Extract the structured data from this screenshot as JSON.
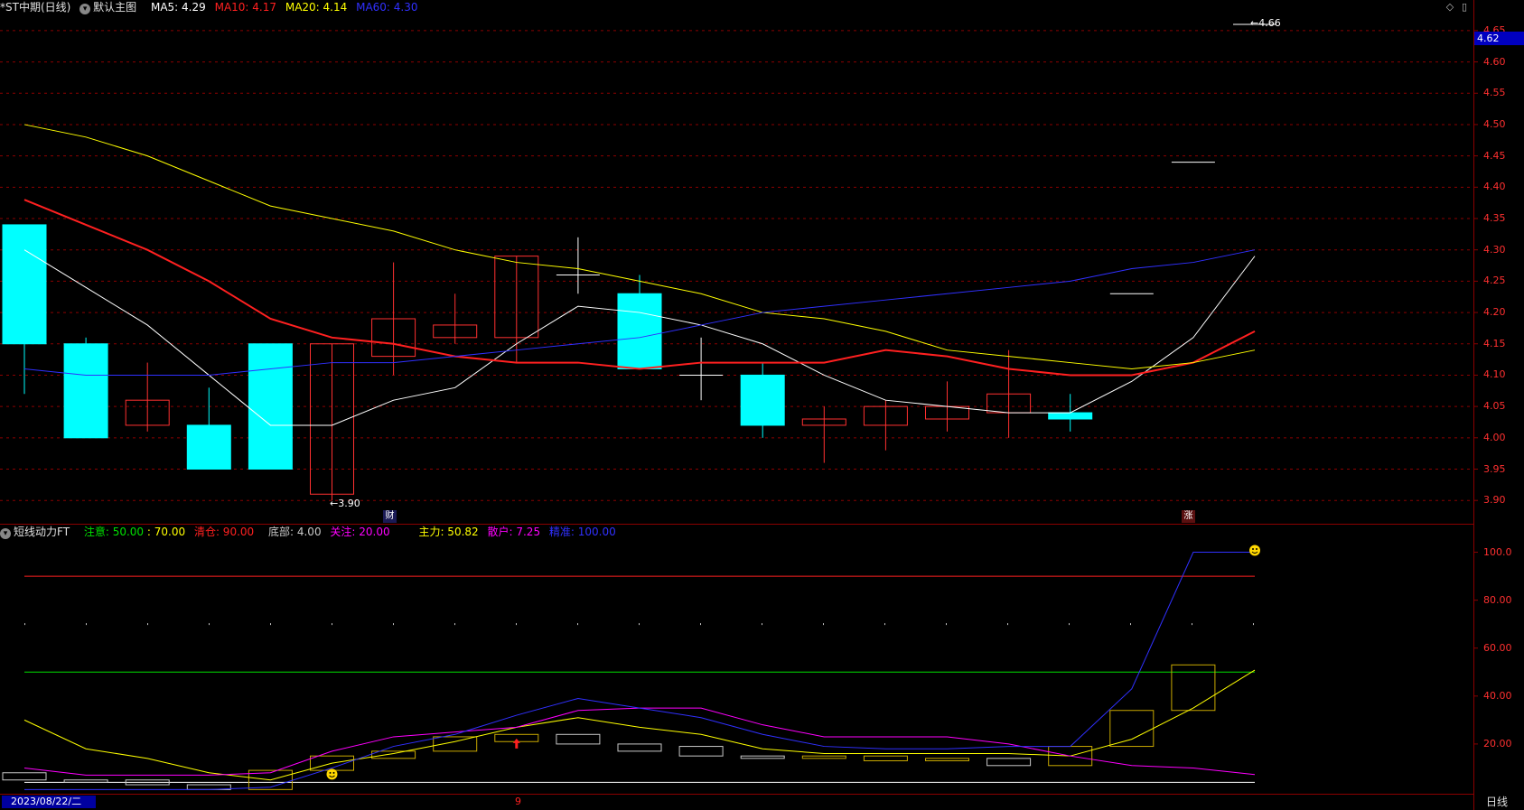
{
  "main": {
    "title": "*ST中期(日线)",
    "template": "默认主图",
    "ma_labels": [
      {
        "label": "MA5: 4.29",
        "color": "#ffffff"
      },
      {
        "label": "MA10: 4.17",
        "color": "#ff2020"
      },
      {
        "label": "MA20: 4.14",
        "color": "#ffff00"
      },
      {
        "label": "MA60: 4.30",
        "color": "#3030ff"
      }
    ],
    "current_price_tag": "4.62",
    "high_annotation": "←4.66",
    "low_annotation": "←3.90",
    "marker_cai": "财",
    "marker_zhang": "涨",
    "yticks": [
      "4.65",
      "4.60",
      "4.55",
      "4.50",
      "4.45",
      "4.40",
      "4.35",
      "4.30",
      "4.25",
      "4.20",
      "4.15",
      "4.10",
      "4.05",
      "4.00",
      "3.95",
      "3.90"
    ]
  },
  "sub": {
    "title": "短线动力FT",
    "labels": [
      {
        "label": "注意: 50.00",
        "color": "#00e000"
      },
      {
        "label": ": 70.00",
        "color": "#ffff00"
      },
      {
        "label": "清仓: 90.00",
        "color": "#ff2020"
      },
      {
        "label": "底部: 4.00",
        "color": "#c8c8c8"
      },
      {
        "label": "关注: 20.00",
        "color": "#ff00ff"
      },
      {
        "label": "主力: 50.82",
        "color": "#ffff00"
      },
      {
        "label": "散户: 7.25",
        "color": "#ff00ff"
      },
      {
        "label": "精准: 100.00",
        "color": "#3030ff"
      }
    ],
    "yticks": [
      "100.0",
      "80.00",
      "60.00",
      "40.00",
      "20.00"
    ]
  },
  "footer": {
    "date": "2023/08/22/二",
    "marker": "9",
    "period": "日线"
  },
  "chart_data": [
    {
      "type": "candlestick",
      "ylim": [
        3.87,
        4.67
      ],
      "candles": [
        {
          "o": 4.34,
          "h": 4.34,
          "l": 4.07,
          "c": 4.15
        },
        {
          "o": 4.15,
          "h": 4.16,
          "l": 4.0,
          "c": 4.0
        },
        {
          "o": 4.02,
          "h": 4.12,
          "l": 4.01,
          "c": 4.06
        },
        {
          "o": 4.02,
          "h": 4.08,
          "l": 3.95,
          "c": 3.95
        },
        {
          "o": 4.15,
          "h": 4.15,
          "l": 3.95,
          "c": 3.95
        },
        {
          "o": 3.91,
          "h": 4.15,
          "l": 3.9,
          "c": 4.15
        },
        {
          "o": 4.13,
          "h": 4.28,
          "l": 4.1,
          "c": 4.19
        },
        {
          "o": 4.16,
          "h": 4.23,
          "l": 4.15,
          "c": 4.18
        },
        {
          "o": 4.16,
          "h": 4.29,
          "l": 4.12,
          "c": 4.29
        },
        {
          "o": 4.26,
          "h": 4.32,
          "l": 4.23,
          "c": 4.26
        },
        {
          "o": 4.23,
          "h": 4.26,
          "l": 4.11,
          "c": 4.11
        },
        {
          "o": 4.1,
          "h": 4.16,
          "l": 4.06,
          "c": 4.1
        },
        {
          "o": 4.1,
          "h": 4.12,
          "l": 4.0,
          "c": 4.02
        },
        {
          "o": 4.02,
          "h": 4.05,
          "l": 3.96,
          "c": 4.03
        },
        {
          "o": 4.02,
          "h": 4.06,
          "l": 3.98,
          "c": 4.05
        },
        {
          "o": 4.03,
          "h": 4.09,
          "l": 4.01,
          "c": 4.05
        },
        {
          "o": 4.04,
          "h": 4.14,
          "l": 4.0,
          "c": 4.07
        },
        {
          "o": 4.04,
          "h": 4.07,
          "l": 4.01,
          "c": 4.03
        },
        {
          "o": 4.23,
          "h": 4.23,
          "l": 4.23,
          "c": 4.23
        },
        {
          "o": 4.44,
          "h": 4.44,
          "l": 4.44,
          "c": 4.44
        },
        {
          "o": 4.66,
          "h": 4.66,
          "l": 4.66,
          "c": 4.66
        }
      ],
      "series": [
        {
          "name": "MA5",
          "color": "#ffffff",
          "values": [
            4.3,
            4.24,
            4.18,
            4.1,
            4.02,
            4.02,
            4.06,
            4.08,
            4.15,
            4.21,
            4.2,
            4.18,
            4.15,
            4.1,
            4.06,
            4.05,
            4.04,
            4.04,
            4.09,
            4.16,
            4.29
          ]
        },
        {
          "name": "MA10",
          "color": "#ff2020",
          "values": [
            4.38,
            4.34,
            4.3,
            4.25,
            4.19,
            4.16,
            4.15,
            4.13,
            4.12,
            4.12,
            4.11,
            4.12,
            4.12,
            4.12,
            4.14,
            4.13,
            4.11,
            4.1,
            4.1,
            4.12,
            4.17
          ]
        },
        {
          "name": "MA20",
          "color": "#ffff00",
          "values": [
            4.5,
            4.48,
            4.45,
            4.41,
            4.37,
            4.35,
            4.33,
            4.3,
            4.28,
            4.27,
            4.25,
            4.23,
            4.2,
            4.19,
            4.17,
            4.14,
            4.13,
            4.12,
            4.11,
            4.12,
            4.14
          ]
        },
        {
          "name": "MA60",
          "color": "#3030ff",
          "values": [
            4.11,
            4.1,
            4.1,
            4.1,
            4.11,
            4.12,
            4.12,
            4.13,
            4.14,
            4.15,
            4.16,
            4.18,
            4.2,
            4.21,
            4.22,
            4.23,
            4.24,
            4.25,
            4.27,
            4.28,
            4.3
          ]
        }
      ]
    },
    {
      "type": "line",
      "ylim": [
        0,
        110
      ],
      "hlines": [
        {
          "value": 90,
          "color": "#ff2020"
        },
        {
          "value": 70,
          "color": "#c8c8c8",
          "style": "dotted"
        },
        {
          "value": 50,
          "color": "#00e000"
        },
        {
          "value": 4,
          "color": "#ffffff"
        }
      ],
      "series": [
        {
          "name": "主力",
          "color": "#ffff00",
          "values": [
            30,
            18,
            14,
            8,
            5,
            12,
            16,
            21,
            27,
            31,
            27,
            24,
            18,
            16,
            16,
            16,
            16,
            15,
            22,
            35,
            50.82
          ]
        },
        {
          "name": "散户",
          "color": "#ff00ff",
          "values": [
            10,
            7,
            7,
            7,
            8,
            17,
            23,
            25,
            27,
            34,
            35,
            35,
            28,
            23,
            23,
            23,
            20,
            15,
            11,
            10,
            7.25
          ]
        },
        {
          "name": "精准",
          "color": "#3030ff",
          "values": [
            1,
            1,
            1,
            1,
            2,
            10,
            19,
            24,
            32,
            39,
            35,
            31,
            24,
            19,
            18,
            18,
            19,
            19,
            43,
            100,
            100
          ]
        }
      ],
      "boxes": [
        {
          "lo": 5,
          "hi": 8,
          "color": "#c8c8c8"
        },
        {
          "lo": 4,
          "hi": 5,
          "color": "#c8c8c8"
        },
        {
          "lo": 3,
          "hi": 5,
          "color": "#c8c8c8"
        },
        {
          "lo": 1,
          "hi": 3,
          "color": "#c8c8c8"
        },
        {
          "lo": 1,
          "hi": 9,
          "color": "#c8a800"
        },
        {
          "lo": 9,
          "hi": 15,
          "color": "#c8a800"
        },
        {
          "lo": 14,
          "hi": 17,
          "color": "#c8a800"
        },
        {
          "lo": 17,
          "hi": 23,
          "color": "#c8a800"
        },
        {
          "lo": 21,
          "hi": 24,
          "color": "#c8a800"
        },
        {
          "lo": 20,
          "hi": 24,
          "color": "#c8c8c8"
        },
        {
          "lo": 17,
          "hi": 20,
          "color": "#c8c8c8"
        },
        {
          "lo": 15,
          "hi": 19,
          "color": "#c8c8c8"
        },
        {
          "lo": 14,
          "hi": 15,
          "color": "#c8c8c8"
        },
        {
          "lo": 14,
          "hi": 15,
          "color": "#c8a800"
        },
        {
          "lo": 13,
          "hi": 15,
          "color": "#c8a800"
        },
        {
          "lo": 13,
          "hi": 14,
          "color": "#c8a800"
        },
        {
          "lo": 11,
          "hi": 14,
          "color": "#c8c8c8"
        },
        {
          "lo": 11,
          "hi": 19,
          "color": "#c8a800"
        },
        {
          "lo": 19,
          "hi": 34,
          "color": "#c8a800"
        },
        {
          "lo": 34,
          "hi": 53,
          "color": "#c8a800"
        }
      ]
    }
  ]
}
